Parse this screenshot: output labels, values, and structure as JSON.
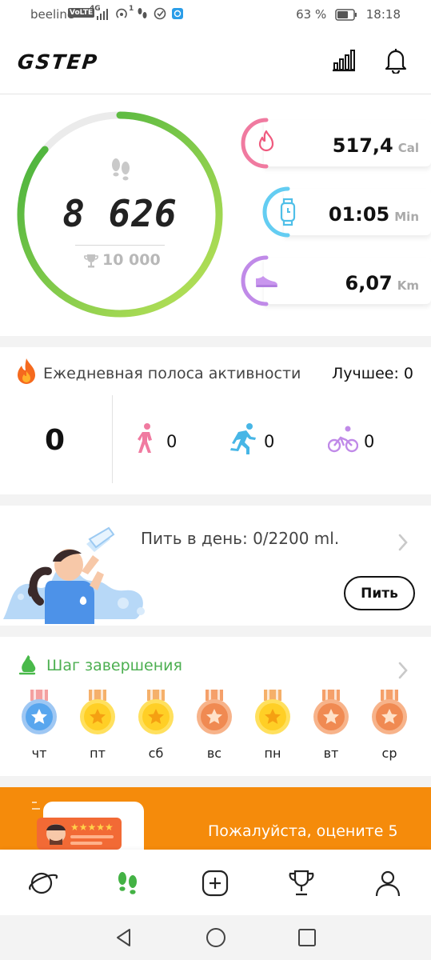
{
  "status_bar": {
    "carrier": "beeline",
    "volte": "VoLTE",
    "network": "4G",
    "signal_sup": "1",
    "battery": "63 %",
    "time": "18:18"
  },
  "header": {
    "logo": "GSTEP",
    "icons": [
      "stats-icon",
      "bell-icon"
    ]
  },
  "steps": {
    "value": "8 626",
    "goal": "10 000",
    "progress": 0.863
  },
  "metrics": {
    "calories": {
      "value": "517,4",
      "unit": "Cal"
    },
    "time": {
      "value": "01:05",
      "unit": "Min"
    },
    "distance": {
      "value": "6,07",
      "unit": "Km"
    }
  },
  "streak": {
    "title": "Ежедневная полоса активности",
    "best": "Лучшее: 0",
    "count": "0",
    "walk": "0",
    "run": "0",
    "bike": "0"
  },
  "water": {
    "text": "Пить в день: 0/2200 ml.",
    "button": "Пить"
  },
  "medals": {
    "title": "Шаг завершения",
    "days": [
      "чт",
      "пт",
      "сб",
      "вс",
      "пн",
      "вт",
      "ср"
    ]
  },
  "promo": {
    "text": "Пожалуйста, оцените 5"
  },
  "colors": {
    "green": "#7bc24a",
    "orange": "#f58b0b",
    "pink": "#ee6a8a",
    "blue": "#5bc8f0",
    "purple": "#b27ee0"
  }
}
